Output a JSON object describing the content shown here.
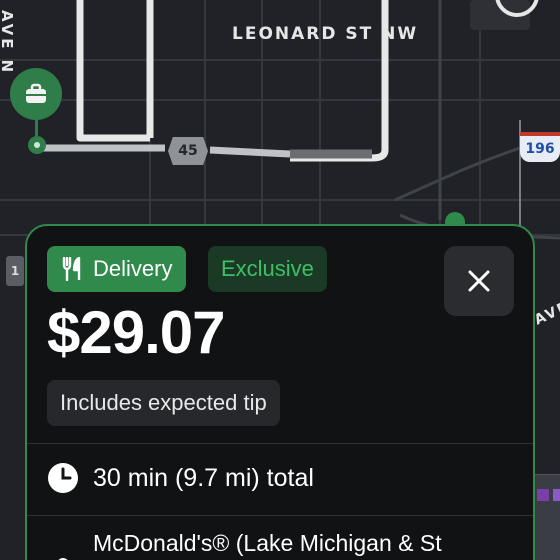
{
  "map": {
    "street_top": "LEONARD ST NW",
    "street_left": "AVE N",
    "street_right": "AVE",
    "route_shield": "45",
    "interstate_shield": "196",
    "left_marker": "1",
    "colors": {
      "background": "#202227",
      "route": "#e8e8e8",
      "pin": "#2f7d49"
    }
  },
  "offer": {
    "type_label": "Delivery",
    "exclusive_label": "Exclusive",
    "price": "$29.07",
    "tip_note": "Includes expected tip",
    "time_distance": "30 min (9.7 mi) total",
    "store_name": "McDonald's® (Lake Michigan & St",
    "icons": {
      "type": "fork-knife-icon",
      "close": "close-icon",
      "time": "clock-icon",
      "store": "location-pin-icon",
      "pin": "briefcase-icon"
    },
    "colors": {
      "accent": "#2f8a4b",
      "exclusive_text": "#3fbf66",
      "card_bg": "#111214"
    }
  }
}
